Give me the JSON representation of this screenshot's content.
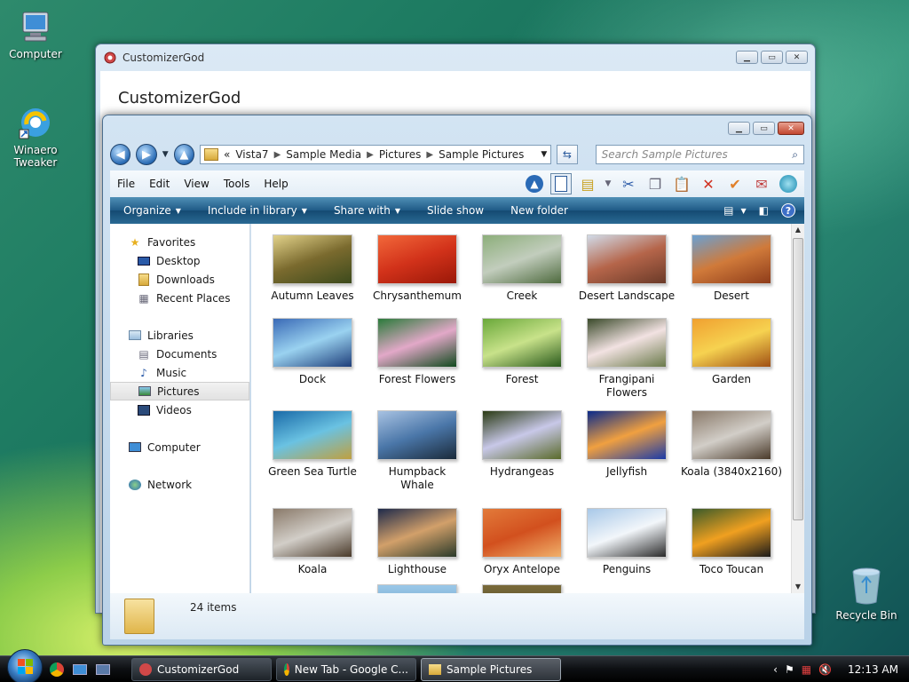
{
  "desktop": {
    "icons": [
      {
        "label": "Computer",
        "icon": "computer-icon"
      },
      {
        "label": "Winaero\nTweaker",
        "line1": "Winaero",
        "line2": "Tweaker",
        "icon": "winaero-tweaker-icon"
      },
      {
        "label": "Recycle Bin",
        "icon": "recycle-bin-icon"
      }
    ]
  },
  "customizer_window": {
    "title": "CustomizerGod",
    "heading": "CustomizerGod"
  },
  "explorer": {
    "address": {
      "chevron": "«",
      "crumbs": [
        "Vista7",
        "Sample Media",
        "Pictures",
        "Sample Pictures"
      ]
    },
    "search_placeholder": "Search Sample Pictures",
    "menu": [
      "File",
      "Edit",
      "View",
      "Tools",
      "Help"
    ],
    "commands": {
      "organize": "Organize",
      "include": "Include in library",
      "share": "Share with",
      "slideshow": "Slide show",
      "new_folder": "New folder"
    },
    "nav": {
      "favorites": "Favorites",
      "desktop": "Desktop",
      "downloads": "Downloads",
      "recent": "Recent Places",
      "libraries": "Libraries",
      "documents": "Documents",
      "music": "Music",
      "pictures": "Pictures",
      "videos": "Videos",
      "computer": "Computer",
      "network": "Network"
    },
    "items": [
      {
        "name": "Autumn Leaves",
        "colors": [
          "#e2d28a",
          "#7a6a2e",
          "#3c4a1c"
        ]
      },
      {
        "name": "Chrysanthemum",
        "colors": [
          "#f2683a",
          "#d2321a",
          "#9a1808"
        ]
      },
      {
        "name": "Creek",
        "colors": [
          "#8cae7a",
          "#c2cdbd",
          "#4e6a3e"
        ]
      },
      {
        "name": "Desert Landscape",
        "colors": [
          "#d1dbe8",
          "#b5654a",
          "#6a3a28"
        ]
      },
      {
        "name": "Desert",
        "colors": [
          "#6aa0d2",
          "#d07a3a",
          "#8e3c1a"
        ]
      },
      {
        "name": "Dock",
        "colors": [
          "#3a6ab6",
          "#9ad2f0",
          "#1e3e7a"
        ]
      },
      {
        "name": "Forest Flowers",
        "colors": [
          "#2a7a3a",
          "#e2a8c8",
          "#114a1e"
        ]
      },
      {
        "name": "Forest",
        "colors": [
          "#6aa83a",
          "#c8e28a",
          "#2a5a1c"
        ]
      },
      {
        "name": "Frangipani\nFlowers",
        "colors": [
          "#3a4a2a",
          "#f2e2e2",
          "#6a7a4a"
        ]
      },
      {
        "name": "Garden",
        "colors": [
          "#f0a030",
          "#f6d250",
          "#a05014"
        ]
      },
      {
        "name": "Green Sea Turtle",
        "colors": [
          "#1a6aa8",
          "#6ac2e2",
          "#c0a040"
        ]
      },
      {
        "name": "Humpback\nWhale",
        "colors": [
          "#a8c2e2",
          "#4a76a8",
          "#1a2a3a"
        ]
      },
      {
        "name": "Hydrangeas",
        "colors": [
          "#2a3a14",
          "#c8c8e8",
          "#5a6a2a"
        ]
      },
      {
        "name": "Jellyfish",
        "colors": [
          "#0a2a8a",
          "#f0a040",
          "#1a3aa8"
        ]
      },
      {
        "name": "Koala (3840x2160)",
        "colors": [
          "#8a7a6a",
          "#d2cec8",
          "#4a3a2a"
        ]
      },
      {
        "name": "Koala",
        "colors": [
          "#8a7a6a",
          "#d2cec8",
          "#4a3a2a"
        ]
      },
      {
        "name": "Lighthouse",
        "colors": [
          "#1e2a4a",
          "#d2a06a",
          "#2a3a2a"
        ]
      },
      {
        "name": "Oryx Antelope",
        "colors": [
          "#e27a3a",
          "#d2501e",
          "#f0b06a"
        ]
      },
      {
        "name": "Penguins",
        "colors": [
          "#a8c8e8",
          "#f2f6fa",
          "#2a2a2a"
        ]
      },
      {
        "name": "Toco Toucan",
        "colors": [
          "#3a5a2a",
          "#f0a020",
          "#1a1a1a"
        ]
      }
    ],
    "status": "24 items"
  },
  "taskbar": {
    "tasks": [
      {
        "label": "CustomizerGod"
      },
      {
        "label": "New Tab - Google C..."
      },
      {
        "label": "Sample Pictures"
      }
    ],
    "clock": "12:13 AM"
  }
}
